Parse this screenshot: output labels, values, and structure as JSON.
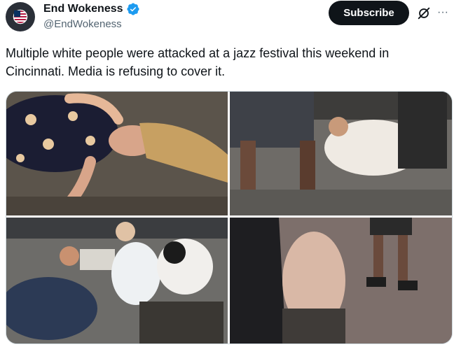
{
  "author": {
    "name": "End Wokeness",
    "handle": "@EndWokeness",
    "verified": true,
    "verified_color": "#1d9bf0"
  },
  "actions": {
    "subscribe_label": "Subscribe",
    "grok_icon": "grok-slash-icon",
    "more_icon": "more-dots-icon",
    "more_glyph": "···"
  },
  "tweet": {
    "text": "Multiple white people were attacked at a jazz festival this weekend in Cincinnati. Media is refusing to cover it."
  },
  "media": {
    "count": 4,
    "alt": [
      "Woman lying on the ground with blonde hair spread out",
      "Man in white shirt on the ground with people standing over him",
      "Men in white shirts crouched and struggling on the ground",
      "Person lying on the pavement beside a car at night"
    ]
  }
}
